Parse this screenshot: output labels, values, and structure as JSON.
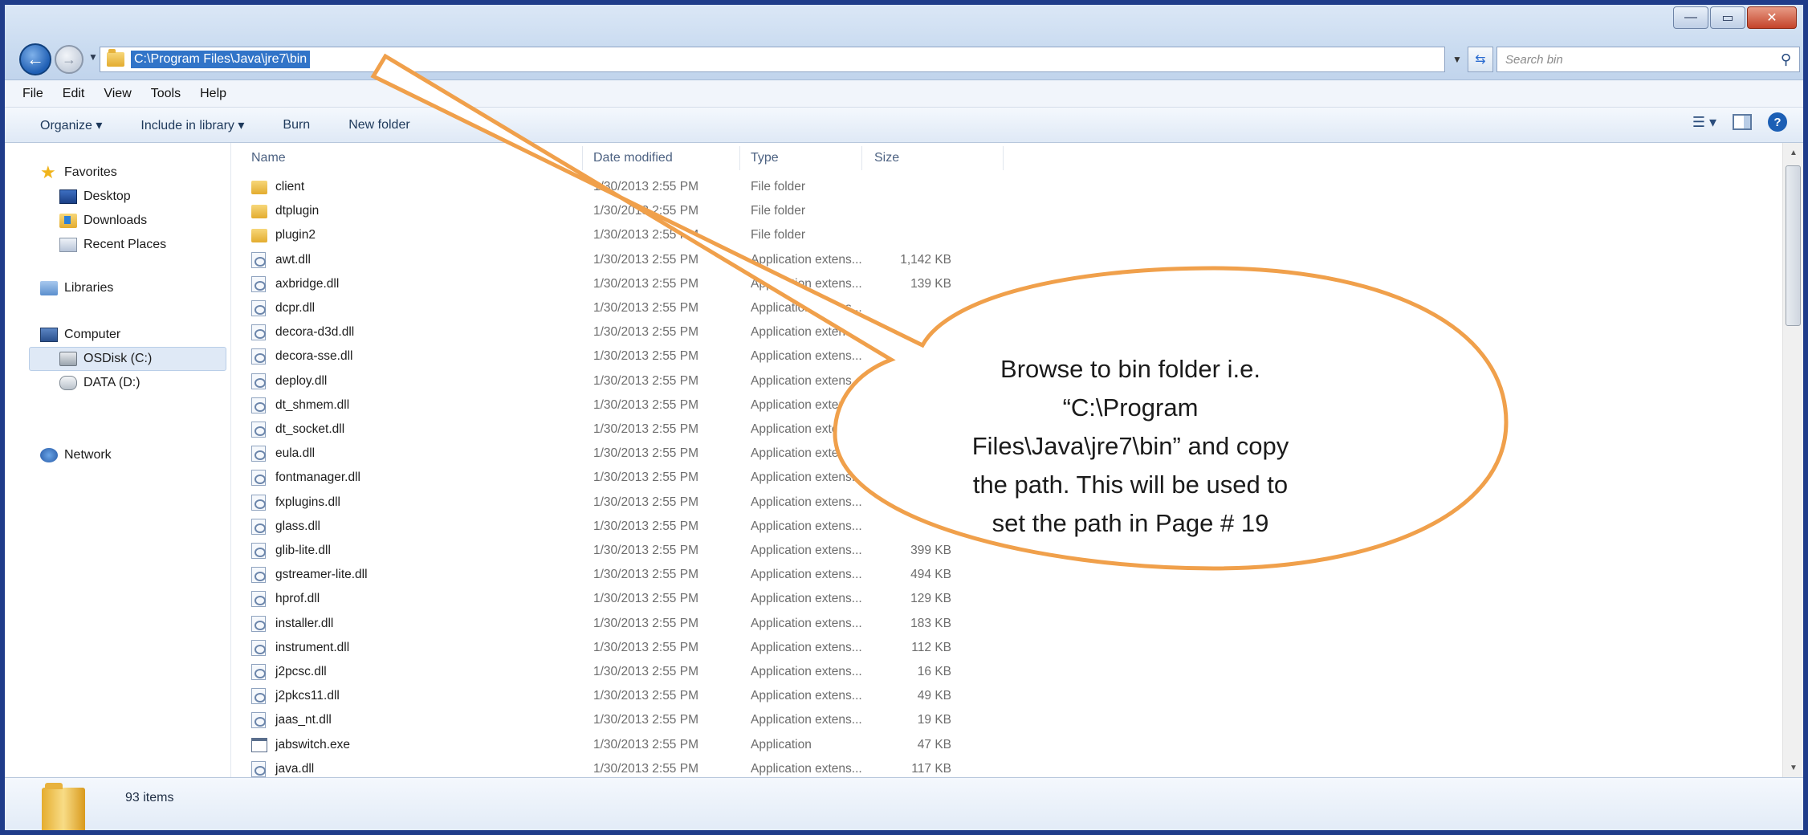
{
  "window": {
    "controls": {
      "minimize": "—",
      "maximize": "▭",
      "close": "✕"
    }
  },
  "address_bar": {
    "path": "C:\\Program Files\\Java\\jre7\\bin",
    "search_placeholder": "Search bin"
  },
  "menu": [
    "File",
    "Edit",
    "View",
    "Tools",
    "Help"
  ],
  "commands": {
    "organize": "Organize ▾",
    "include_in_library": "Include in library ▾",
    "burn": "Burn",
    "new_folder": "New folder"
  },
  "navigation": {
    "favorites": "Favorites",
    "desktop": "Desktop",
    "downloads": "Downloads",
    "recent_places": "Recent Places",
    "libraries": "Libraries",
    "computer": "Computer",
    "osdisk": "OSDisk (C:)",
    "data": "DATA (D:)",
    "network": "Network"
  },
  "columns": {
    "name": "Name",
    "date": "Date modified",
    "type": "Type",
    "size": "Size"
  },
  "files": [
    {
      "name": "client",
      "date": "1/30/2013 2:55 PM",
      "type": "File folder",
      "size": "",
      "kind": "folder"
    },
    {
      "name": "dtplugin",
      "date": "1/30/2013 2:55 PM",
      "type": "File folder",
      "size": "",
      "kind": "folder"
    },
    {
      "name": "plugin2",
      "date": "1/30/2013 2:55 PM",
      "type": "File folder",
      "size": "",
      "kind": "folder"
    },
    {
      "name": "awt.dll",
      "date": "1/30/2013 2:55 PM",
      "type": "Application extens...",
      "size": "1,142 KB",
      "kind": "dll"
    },
    {
      "name": "axbridge.dll",
      "date": "1/30/2013 2:55 PM",
      "type": "Application extens...",
      "size": "139 KB",
      "kind": "dll"
    },
    {
      "name": "dcpr.dll",
      "date": "1/30/2013 2:55 PM",
      "type": "Application extens...",
      "size": "",
      "kind": "dll"
    },
    {
      "name": "decora-d3d.dll",
      "date": "1/30/2013 2:55 PM",
      "type": "Application extens...",
      "size": "",
      "kind": "dll"
    },
    {
      "name": "decora-sse.dll",
      "date": "1/30/2013 2:55 PM",
      "type": "Application extens...",
      "size": "",
      "kind": "dll"
    },
    {
      "name": "deploy.dll",
      "date": "1/30/2013 2:55 PM",
      "type": "Application extens...",
      "size": "",
      "kind": "dll"
    },
    {
      "name": "dt_shmem.dll",
      "date": "1/30/2013 2:55 PM",
      "type": "Application extens...",
      "size": "",
      "kind": "dll"
    },
    {
      "name": "dt_socket.dll",
      "date": "1/30/2013 2:55 PM",
      "type": "Application extens...",
      "size": "",
      "kind": "dll"
    },
    {
      "name": "eula.dll",
      "date": "1/30/2013 2:55 PM",
      "type": "Application extens...",
      "size": "",
      "kind": "dll"
    },
    {
      "name": "fontmanager.dll",
      "date": "1/30/2013 2:55 PM",
      "type": "Application extens...",
      "size": "",
      "kind": "dll"
    },
    {
      "name": "fxplugins.dll",
      "date": "1/30/2013 2:55 PM",
      "type": "Application extens...",
      "size": "",
      "kind": "dll"
    },
    {
      "name": "glass.dll",
      "date": "1/30/2013 2:55 PM",
      "type": "Application extens...",
      "size": "",
      "kind": "dll"
    },
    {
      "name": "glib-lite.dll",
      "date": "1/30/2013 2:55 PM",
      "type": "Application extens...",
      "size": "399 KB",
      "kind": "dll"
    },
    {
      "name": "gstreamer-lite.dll",
      "date": "1/30/2013 2:55 PM",
      "type": "Application extens...",
      "size": "494 KB",
      "kind": "dll"
    },
    {
      "name": "hprof.dll",
      "date": "1/30/2013 2:55 PM",
      "type": "Application extens...",
      "size": "129 KB",
      "kind": "dll"
    },
    {
      "name": "installer.dll",
      "date": "1/30/2013 2:55 PM",
      "type": "Application extens...",
      "size": "183 KB",
      "kind": "dll"
    },
    {
      "name": "instrument.dll",
      "date": "1/30/2013 2:55 PM",
      "type": "Application extens...",
      "size": "112 KB",
      "kind": "dll"
    },
    {
      "name": "j2pcsc.dll",
      "date": "1/30/2013 2:55 PM",
      "type": "Application extens...",
      "size": "16 KB",
      "kind": "dll"
    },
    {
      "name": "j2pkcs11.dll",
      "date": "1/30/2013 2:55 PM",
      "type": "Application extens...",
      "size": "49 KB",
      "kind": "dll"
    },
    {
      "name": "jaas_nt.dll",
      "date": "1/30/2013 2:55 PM",
      "type": "Application extens...",
      "size": "19 KB",
      "kind": "dll"
    },
    {
      "name": "jabswitch.exe",
      "date": "1/30/2013 2:55 PM",
      "type": "Application",
      "size": "47 KB",
      "kind": "exe"
    },
    {
      "name": "java.dll",
      "date": "1/30/2013 2:55 PM",
      "type": "Application extens...",
      "size": "117 KB",
      "kind": "dll"
    }
  ],
  "status": {
    "item_count": "93 items"
  },
  "callout": {
    "lines": [
      "Browse to bin folder i.e.",
      "“C:\\Program",
      "Files\\Java\\jre7\\bin” and copy",
      "the path. This will be used to",
      "set the path in Page # 19"
    ],
    "stroke_color": "#f0a04b",
    "fill_color": "#ffffff"
  }
}
